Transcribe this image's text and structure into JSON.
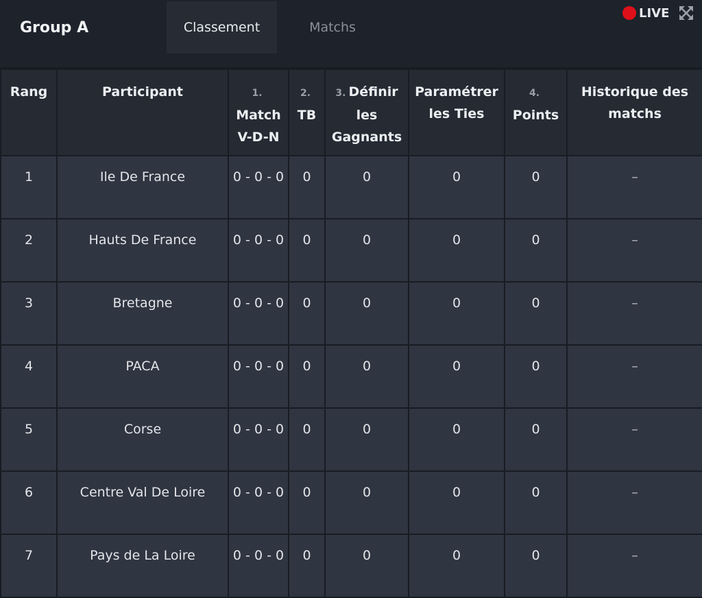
{
  "header": {
    "group_title": "Group A",
    "tabs": [
      {
        "label": "Classement",
        "active": true
      },
      {
        "label": "Matchs",
        "active": false
      }
    ],
    "live_label": "LIVE",
    "live_color": "#e0101a",
    "expand_icon": "expand-arrows-icon"
  },
  "table": {
    "columns": {
      "rank": "Rang",
      "participant": "Participant",
      "match_num": "1.",
      "match": "Match V-D-N",
      "tb_num": "2.",
      "tb": "TB",
      "winners_num": "3.",
      "winners": "Définir les Gagnants",
      "ties": "Paramétrer les Ties",
      "points_num": "4.",
      "points": "Points",
      "history": "Historique des matchs"
    },
    "rows": [
      {
        "rank": "1",
        "participant": "Ile De France",
        "match": "0 - 0 - 0",
        "tb": "0",
        "winners": "0",
        "ties": "0",
        "points": "0",
        "history": "–"
      },
      {
        "rank": "2",
        "participant": "Hauts De France",
        "match": "0 - 0 - 0",
        "tb": "0",
        "winners": "0",
        "ties": "0",
        "points": "0",
        "history": "–"
      },
      {
        "rank": "3",
        "participant": "Bretagne",
        "match": "0 - 0 - 0",
        "tb": "0",
        "winners": "0",
        "ties": "0",
        "points": "0",
        "history": "–"
      },
      {
        "rank": "4",
        "participant": "PACA",
        "match": "0 - 0 - 0",
        "tb": "0",
        "winners": "0",
        "ties": "0",
        "points": "0",
        "history": "–"
      },
      {
        "rank": "5",
        "participant": "Corse",
        "match": "0 - 0 - 0",
        "tb": "0",
        "winners": "0",
        "ties": "0",
        "points": "0",
        "history": "–"
      },
      {
        "rank": "6",
        "participant": "Centre Val De Loire",
        "match": "0 - 0 - 0",
        "tb": "0",
        "winners": "0",
        "ties": "0",
        "points": "0",
        "history": "–"
      },
      {
        "rank": "7",
        "participant": "Pays de La Loire",
        "match": "0 - 0 - 0",
        "tb": "0",
        "winners": "0",
        "ties": "0",
        "points": "0",
        "history": "–"
      }
    ]
  }
}
